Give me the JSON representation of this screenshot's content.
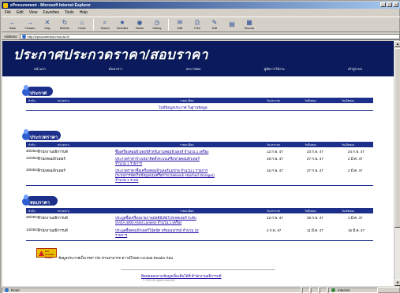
{
  "window": {
    "title": "eProcurement - Microsoft Internet Explorer",
    "buttons": [
      "_",
      "□",
      "×"
    ]
  },
  "menu": [
    "File",
    "Edit",
    "View",
    "Favorites",
    "Tools",
    "Help"
  ],
  "toolbar": [
    {
      "label": "Back",
      "glyph": "←"
    },
    {
      "label": "Forward",
      "glyph": "→"
    },
    {
      "label": "Stop",
      "glyph": "✕"
    },
    {
      "label": "Refresh",
      "glyph": "↻"
    },
    {
      "label": "Home",
      "glyph": "⌂"
    },
    {
      "label": "Search",
      "glyph": "⌕"
    },
    {
      "label": "Favorites",
      "glyph": "★"
    },
    {
      "label": "Media",
      "glyph": "◉"
    },
    {
      "label": "History",
      "glyph": "◷"
    },
    {
      "label": "Mail",
      "glyph": "✉"
    },
    {
      "label": "Print",
      "glyph": "⎙"
    },
    {
      "label": "Edit",
      "glyph": "✎"
    },
    {
      "label": "",
      "glyph": "▤"
    },
    {
      "label": "Discuss",
      "glyph": "▦"
    }
  ],
  "address": {
    "label": "Address",
    "url": "http://eprocurement.mnu.ac.th"
  },
  "page": {
    "header_title": "ประกาศประกวดราคา/สอบราคา",
    "nav": [
      "หน้าแรก",
      "ค้นหาข่าว",
      "ประกาศผล",
      "คู่มือการใช้งาน",
      "เข้าสู่ระบบ"
    ]
  },
  "sections": [
    {
      "title": "ประกาศ",
      "columns": [
        "ลำดับ",
        "หน่วยงาน",
        "รายละเอียด",
        "วันประกาศ",
        "วันยื่นซอง",
        "วันเปิดซอง"
      ],
      "empty_message": "ไม่มีข้อมูลประกาศ ในฐานข้อมูล",
      "rows": []
    },
    {
      "title": "ประกวดราคา",
      "columns": [
        "ลำดับ",
        "หน่วยงาน",
        "รายละเอียด",
        "วันประกาศ",
        "วันยื่นซอง",
        "วันเปิดซอง"
      ],
      "rows": [
        {
          "no": "30/2547",
          "unit": "สำนักงานอธิการบดี",
          "desc": [
            "ซื้อเครื่องคอมพิวเตอร์สำหรับงานคอมพิวเตอร์ จำนวน 1 เครื่อง"
          ],
          "announce": "12 ก.พ. 47",
          "submit": "23 ก.พ. 47",
          "open": "24 ก.พ. 47"
        },
        {
          "no": "12/2547",
          "unit": "สำนักคอมพิวเตอร์",
          "desc": [
            "ประกวดราคาจ้างเหมาติดตั้งระบบเครือข่ายคอมพิวเตอร์",
            "จำนวน 1 รายการ"
          ],
          "announce": "19 ก.พ. 47",
          "submit": "27 ก.พ. 47",
          "open": "2 มี.ค. 47"
        },
        {
          "no": "10/2547",
          "unit": "สำนักคอมพิวเตอร์",
          "desc": [
            "ประกวดราคาซื้อเครื่องคอมพิวเตอร์แม่ข่าย จำนวน 1 รายการ",
            "(ระบบการจัดเก็บข้อมูลบนเครือข่าย (Network Attached Storage))",
            "จำนวน 1 ระบบ"
          ],
          "announce": "16 ก.พ. 47",
          "submit": "27 ก.พ. 47",
          "open": "2 มี.ค. 47"
        }
      ]
    },
    {
      "title": "สอบราคา",
      "columns": [
        "ลำดับ",
        "หน่วยงาน",
        "รายละเอียด",
        "วันประกาศ",
        "วันยื่นซอง",
        "วันเปิดซอง"
      ],
      "rows": [
        {
          "no": "29/2547",
          "unit": "สำนักงานอธิการบดี",
          "desc": [
            "ประมูลซื้อเครื่องฉายภาพมัลติมีเดียโปรเจคเตอร์ ระดับ",
            "SVGA 4000 ANSI Lumens จำนวน 1 เครื่อง"
          ],
          "announce": "12 ก.พ. 47",
          "submit": "25 ก.พ. 47",
          "open": "1 มี.ค. 47"
        },
        {
          "no": "14/2547",
          "unit": "สำนักงานอธิการบดี",
          "desc": [
            "ประมูลซื้อคอมพิวเตอร์โน้ตบุ๊ค พร้อมอุปกรณ์ จำนวน 32",
            "รายการ"
          ],
          "announce": "4 ก.พ. 47",
          "submit": "11 มี.ค. 47",
          "open": "15 มี.ค. 47"
        }
      ]
    }
  ],
  "footer": {
    "acrobat_badge": "Get Acrobat Reader",
    "pdf_note": "ข้อมูลประกาศเป็น PDF File ท่านสามารถ ดาวน์โหลด Acrobat Reader ก่อน",
    "link": "ติดต่อสอบถามข้อมูลเพิ่มเติมได้ที่ สำนักงานอธิการบดี",
    "copyright": "© 2004 All rights reserved."
  },
  "status": {
    "left": "Done",
    "zone": "Internet"
  }
}
